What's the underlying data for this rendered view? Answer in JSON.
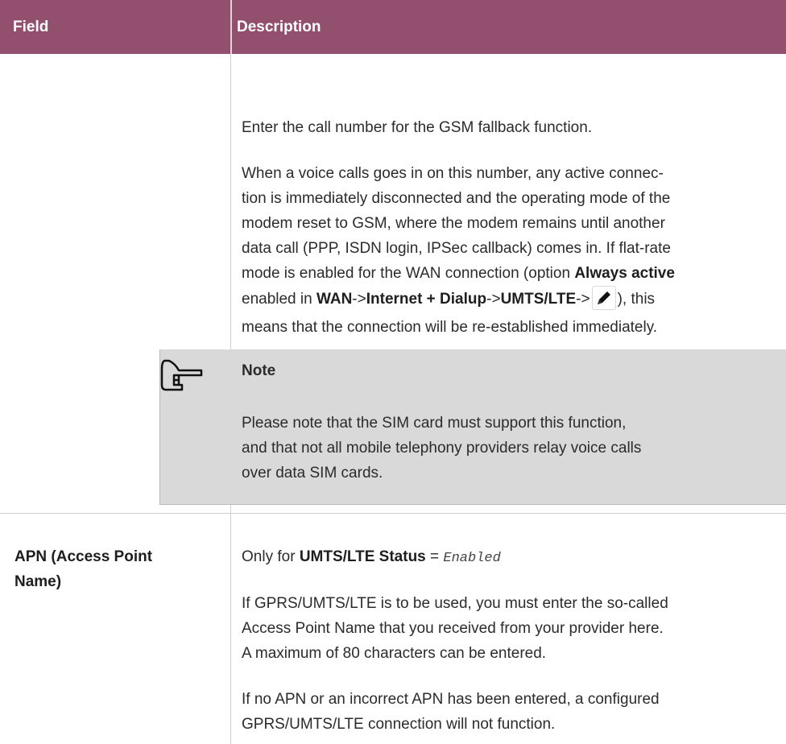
{
  "header": {
    "col_field": "Field",
    "col_description": "Description"
  },
  "row1": {
    "p1": "Enter the call number for the GSM fallback function.",
    "p2_line1": "When a voice calls goes in on this number, any active connec-",
    "p2_line2": "tion is immediately disconnected and the operating mode of the",
    "p2_line3": "modem reset to GSM, where the modem remains until another",
    "p2_line4": "data call (PPP, ISDN login, IPSec callback) comes in. If flat-rate",
    "p2_line5_pre": "mode is enabled for the WAN connection (option ",
    "p2_line5_bold": "Always active",
    "p2_line6_pre": "enabled in ",
    "p2_line6_wan": "WAN",
    "arrow": "->",
    "p2_line6_internet": "Internet + Dialup",
    "p2_line6_umts": "UMTS/LTE",
    "p2_line6_post": "), this",
    "p2_line7": "means that the connection will be re-established immediately.",
    "icon": "pencil-edit-icon"
  },
  "note": {
    "icon": "pointing-hand-icon",
    "title": "Note",
    "line1": "Please note that the SIM card must support this function,",
    "line2": "and that not all mobile telephony providers relay voice calls",
    "line3": "over data SIM cards."
  },
  "row2": {
    "field_line1": "APN (Access Point",
    "field_line2": "Name)",
    "p1_pre": "Only for ",
    "p1_bold": "UMTS/LTE Status",
    "p1_eq": " = ",
    "p1_value": "Enabled",
    "p2_line1": "If GPRS/UMTS/LTE is to be used, you must enter the so-called",
    "p2_line2": "Access Point Name that you received from your provider here.",
    "p2_line3": "A maximum of 80 characters can be entered.",
    "p3_line1": "If no APN or an incorrect APN has been entered, a configured",
    "p3_line2": "GPRS/UMTS/LTE connection will not function."
  },
  "colors": {
    "header_bg": "#92506e",
    "note_bg": "#d9d9d9",
    "text": "#2b2b2b"
  }
}
